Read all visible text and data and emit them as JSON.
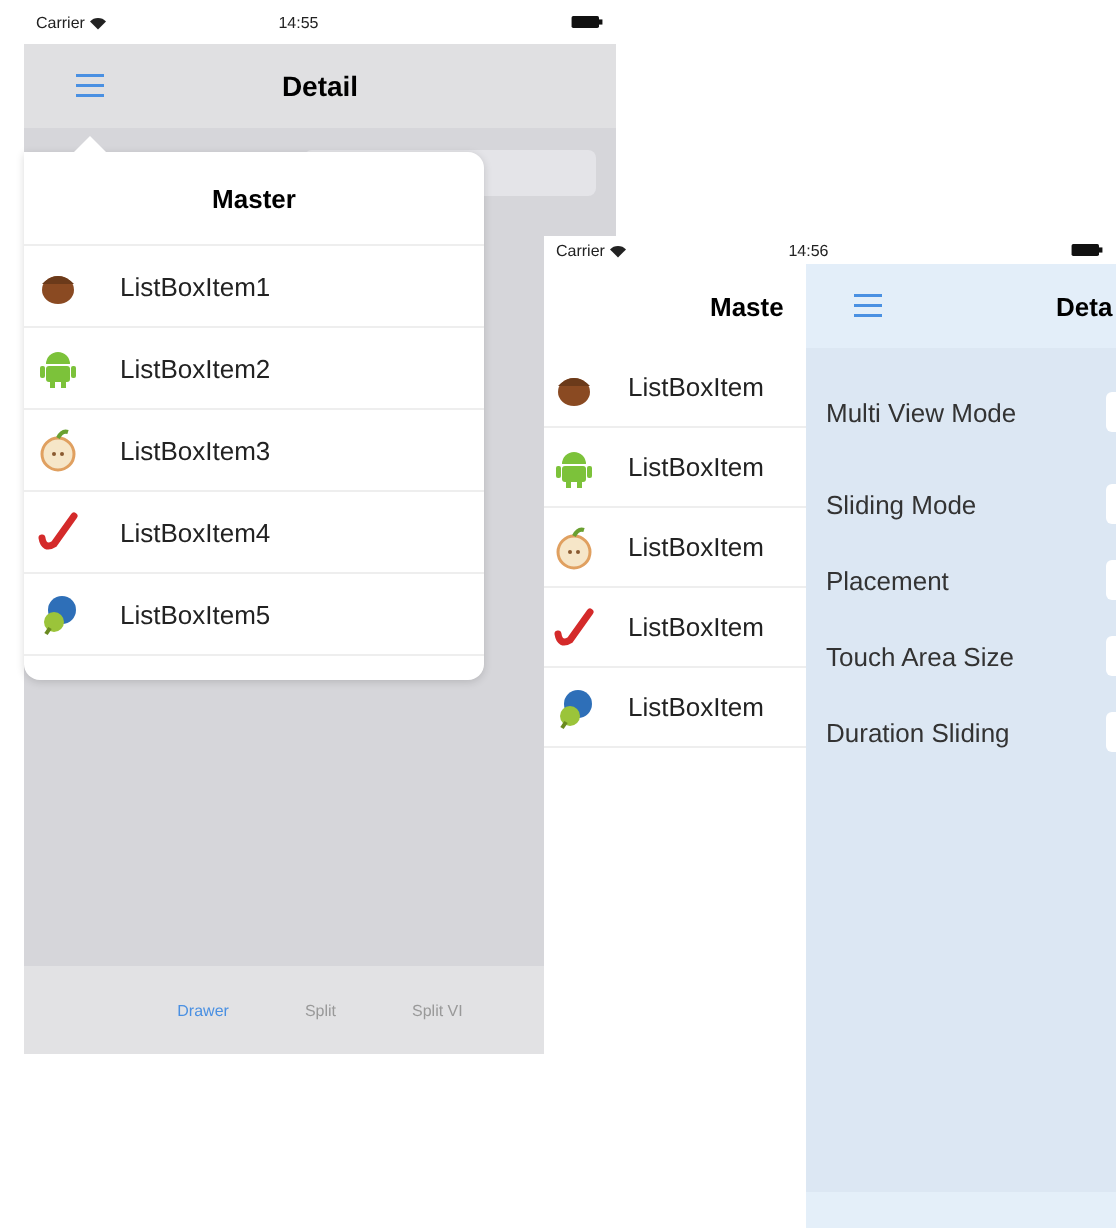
{
  "left_screen": {
    "status_bar": {
      "carrier": "Carrier",
      "time": "14:55"
    },
    "nav_bar": {
      "title": "Detail"
    },
    "popover": {
      "title": "Master",
      "items": [
        {
          "label": "ListBoxItem1"
        },
        {
          "label": "ListBoxItem2"
        },
        {
          "label": "ListBoxItem3"
        },
        {
          "label": "ListBoxItem4"
        },
        {
          "label": "ListBoxItem5"
        }
      ]
    },
    "tab_bar": {
      "tabs": [
        {
          "label": "Drawer",
          "selected": true
        },
        {
          "label": "Split",
          "selected": false
        },
        {
          "label": "Split VI",
          "selected": false
        }
      ]
    }
  },
  "right_screen": {
    "status_bar": {
      "carrier": "Carrier",
      "time": "14:56"
    },
    "master": {
      "title": "Maste",
      "items": [
        {
          "label": "ListBoxItem"
        },
        {
          "label": "ListBoxItem"
        },
        {
          "label": "ListBoxItem"
        },
        {
          "label": "ListBoxItem"
        },
        {
          "label": "ListBoxItem"
        }
      ]
    },
    "detail": {
      "title": "Deta",
      "fields": [
        {
          "label": "Multi View Mode"
        },
        {
          "label": "Sliding Mode"
        },
        {
          "label": "Placement"
        },
        {
          "label": "Touch Area Size"
        },
        {
          "label": "Duration Sliding"
        }
      ]
    }
  }
}
